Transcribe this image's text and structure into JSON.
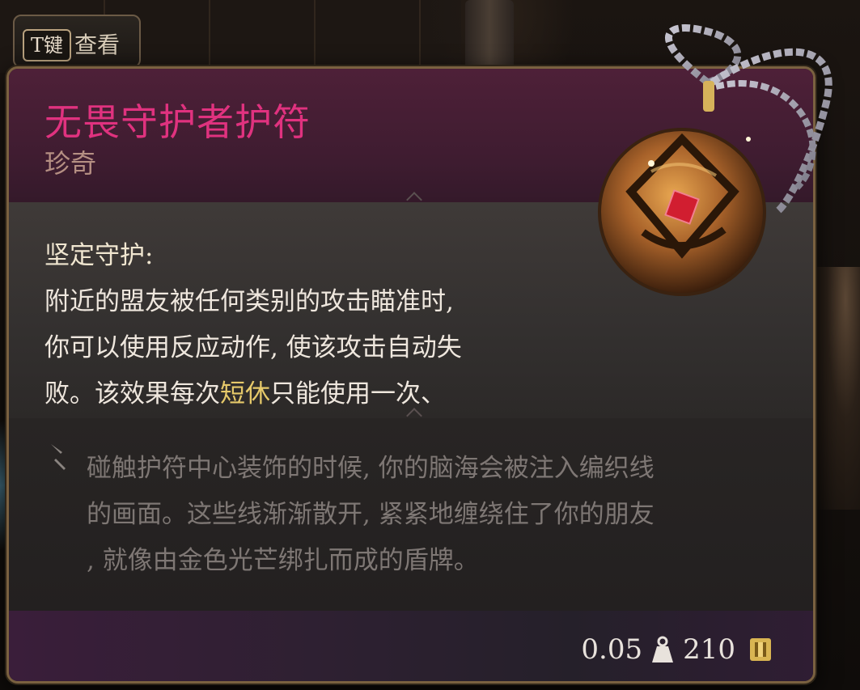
{
  "key_hint": {
    "key": "T键",
    "label": "查看"
  },
  "item": {
    "name": "无畏守护者护符",
    "rarity": "珍奇",
    "passive": {
      "name": "坚定守护:",
      "line1": "附近的盟友被任何类别的攻击瞄准时,",
      "line2": "你可以使用反应动作, 使该攻击自动失",
      "line3_a": "败。该效果每次",
      "line3_highlight": "短休",
      "line3_b": "只能使用一次、"
    },
    "flavor": {
      "line1": "碰触护符中心装饰的时候, 你的脑海会被注入编织线",
      "line2": "的画面。这些线渐渐散开, 紧紧地缠绕住了你的朋友",
      "line3": ", 就像由金色光芒绑扎而成的盾牌。"
    },
    "weight": "0.05",
    "value": "210"
  },
  "colors": {
    "title": "#e0327f",
    "rarity": "#b58f83",
    "highlight": "#e6c96a",
    "flavor_text": "#7e7774",
    "border": "#7a6140"
  },
  "icons": {
    "weight": "weight-icon",
    "gold": "gold-coin-icon",
    "flavor": "quote-mark-icon"
  }
}
